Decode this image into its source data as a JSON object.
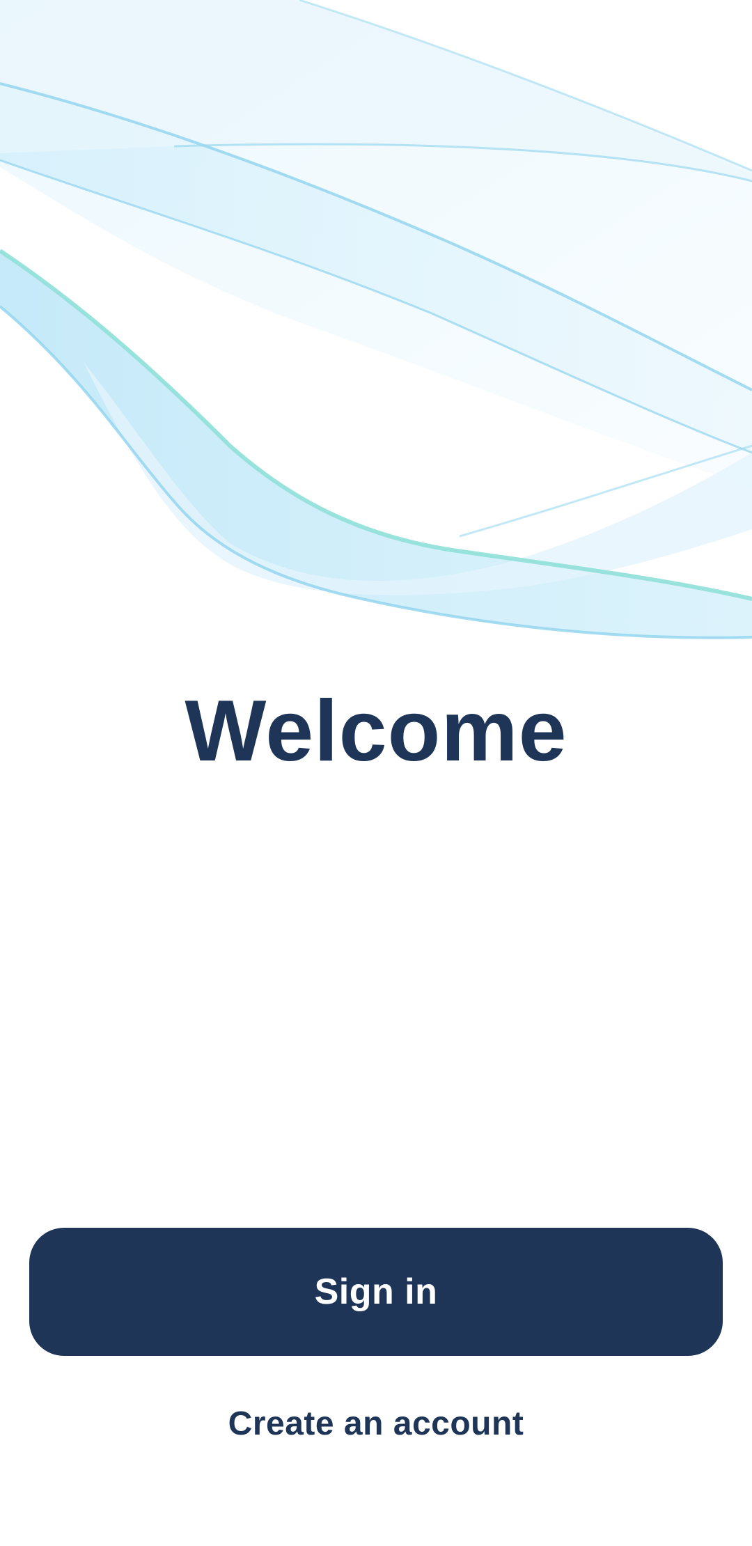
{
  "welcome": {
    "title": "Welcome"
  },
  "actions": {
    "sign_in_label": "Sign in",
    "create_account_label": "Create an account"
  },
  "colors": {
    "primary": "#1e3557",
    "wave_blue": "#8fd3ee",
    "wave_teal": "#8fe0d8",
    "background": "#ffffff"
  }
}
